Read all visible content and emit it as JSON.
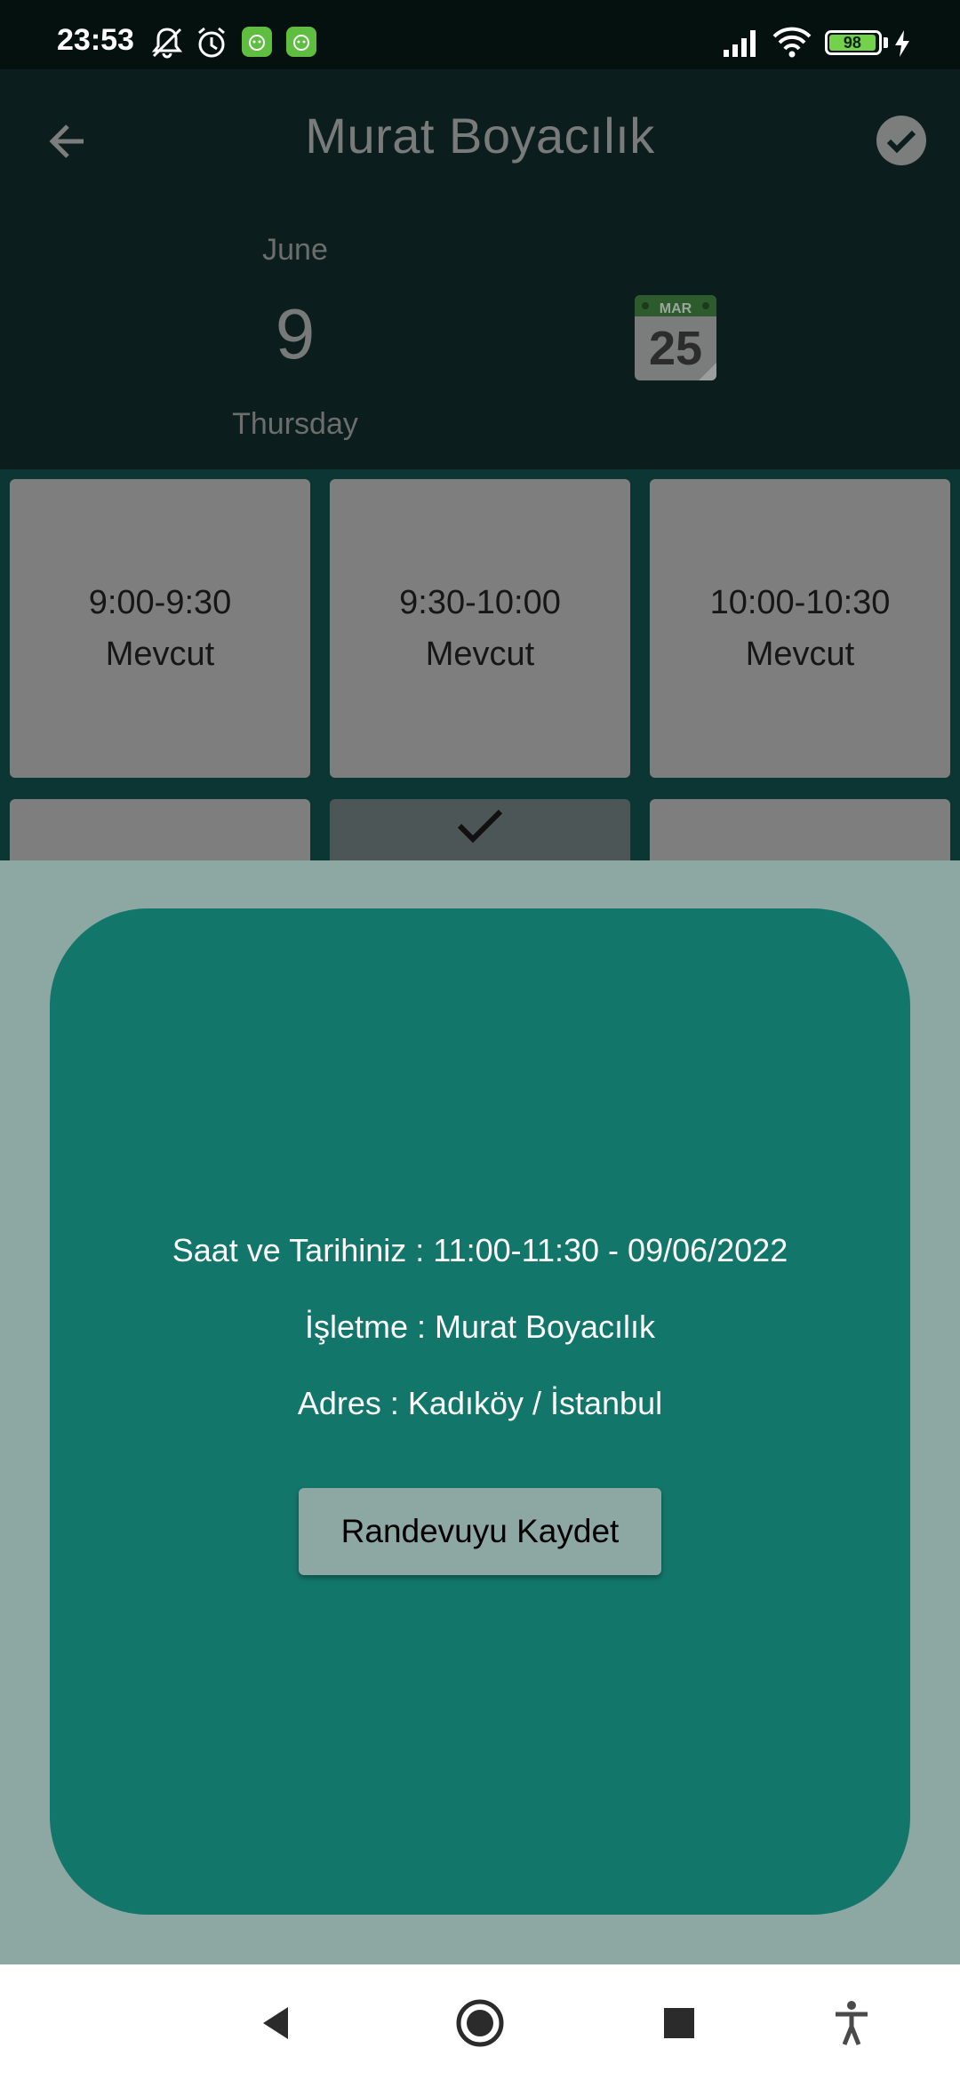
{
  "status_bar": {
    "time": "23:53",
    "battery": "98",
    "icons": [
      "bell-off-icon",
      "alarm-icon",
      "app-icon",
      "app-icon",
      "signal-icon",
      "wifi-icon",
      "battery-icon",
      "charging-icon"
    ]
  },
  "app_bar": {
    "title": "Murat Boyacılık",
    "back_icon": "arrow-left-icon",
    "confirm_icon": "check-circle-icon"
  },
  "date": {
    "month": "June",
    "day": "9",
    "weekday": "Thursday",
    "calendar_icon": "calendar-icon",
    "calendar_icon_month": "MAR",
    "calendar_icon_day": "25"
  },
  "slots": [
    {
      "time": "9:00-9:30",
      "status": "Mevcut"
    },
    {
      "time": "9:30-10:00",
      "status": "Mevcut"
    },
    {
      "time": "10:00-10:30",
      "status": "Mevcut"
    }
  ],
  "dialog": {
    "datetime_line": "Saat ve Tarihiniz : 11:00-11:30 - 09/06/2022",
    "business_line": "İşletme : Murat Boyacılık",
    "address_line": "Adres : Kadıköy / İstanbul",
    "save_button": "Randevuyu Kaydet"
  },
  "nav_bar": {
    "icons": [
      "back-triangle-icon",
      "home-circle-icon",
      "recents-square-icon",
      "accessibility-icon"
    ]
  },
  "colors": {
    "dialog_bg": "#13766a",
    "scrim": "#8da7a3",
    "slot_bg": "#7e7e7e"
  }
}
